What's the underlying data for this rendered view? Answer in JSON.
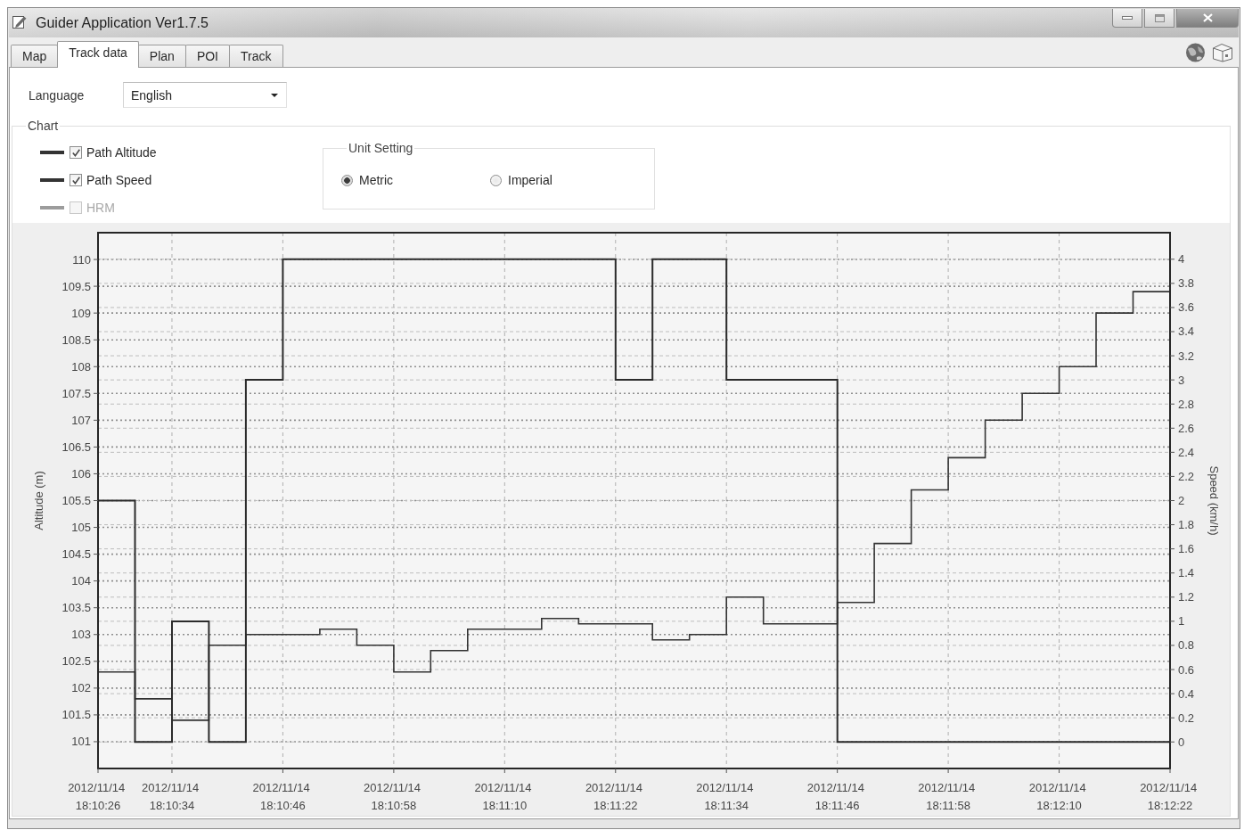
{
  "window": {
    "title": "Guider Application Ver1.7.5"
  },
  "tabs": [
    {
      "label": "Map",
      "selected": false
    },
    {
      "label": "Track data",
      "selected": true
    },
    {
      "label": "Plan",
      "selected": false
    },
    {
      "label": "POI",
      "selected": false
    },
    {
      "label": "Track",
      "selected": false
    }
  ],
  "language": {
    "label": "Language",
    "value": "English"
  },
  "chart_group": {
    "title": "Chart",
    "series_toggles": [
      {
        "label": "Path Altitude",
        "checked": true,
        "disabled": false
      },
      {
        "label": "Path Speed",
        "checked": true,
        "disabled": false
      },
      {
        "label": "HRM",
        "checked": false,
        "disabled": true
      }
    ],
    "unit_setting": {
      "title": "Unit Setting",
      "options": [
        {
          "label": "Metric",
          "selected": true
        },
        {
          "label": "Imperial",
          "selected": false
        }
      ]
    },
    "chart_data": [
      {
        "type": "step",
        "ylabel": "Altitude (m)",
        "y2label": "Speed (km/h)",
        "grid": true,
        "x": [
          "2012-11-14T18:10:26",
          "2012-11-14T18:10:30",
          "2012-11-14T18:10:34",
          "2012-11-14T18:10:38",
          "2012-11-14T18:10:42",
          "2012-11-14T18:10:46",
          "2012-11-14T18:10:50",
          "2012-11-14T18:10:54",
          "2012-11-14T18:10:58",
          "2012-11-14T18:11:02",
          "2012-11-14T18:11:06",
          "2012-11-14T18:11:10",
          "2012-11-14T18:11:14",
          "2012-11-14T18:11:18",
          "2012-11-14T18:11:22",
          "2012-11-14T18:11:26",
          "2012-11-14T18:11:30",
          "2012-11-14T18:11:34",
          "2012-11-14T18:11:38",
          "2012-11-14T18:11:42",
          "2012-11-14T18:11:46",
          "2012-11-14T18:11:50",
          "2012-11-14T18:11:54",
          "2012-11-14T18:11:58",
          "2012-11-14T18:12:02",
          "2012-11-14T18:12:06",
          "2012-11-14T18:12:10",
          "2012-11-14T18:12:14",
          "2012-11-14T18:12:18",
          "2012-11-14T18:12:22"
        ],
        "series": [
          {
            "color": "#333333",
            "values": [
              102.3,
              101.8,
              101.4,
              102.8,
              103.0,
              103.0,
              103.1,
              102.8,
              102.3,
              102.7,
              103.1,
              103.1,
              103.3,
              103.2,
              103.2,
              102.9,
              103.0,
              103.7,
              103.2,
              103.2,
              103.6,
              104.7,
              105.7,
              106.3,
              107.0,
              107.5,
              108.0,
              109.0,
              109.4,
              109.4
            ]
          },
          {
            "color": "#2b2b2b",
            "axis": "y2",
            "values": [
              2,
              0,
              1,
              0,
              3,
              4,
              4,
              4,
              4,
              4,
              4,
              4,
              4,
              4,
              3,
              4,
              4,
              3,
              3,
              3,
              0,
              0,
              0,
              0,
              0,
              0,
              0,
              0,
              0,
              0
            ]
          }
        ],
        "xlim": [
          "2012-11-14T18:10:26",
          "2012-11-14T18:12:22"
        ],
        "ylim": [
          100.5,
          110.5
        ],
        "y2lim": [
          -0.22,
          4.22
        ],
        "xticks": [
          {
            "value": "2012-11-14T18:10:26",
            "label": "2012/11/14 18:10:26"
          },
          {
            "value": "2012-11-14T18:10:34",
            "label": "2012/11/14 18:10:34"
          },
          {
            "value": "2012-11-14T18:10:46",
            "label": "2012/11/14 18:10:46"
          },
          {
            "value": "2012-11-14T18:10:58",
            "label": "2012/11/14 18:10:58"
          },
          {
            "value": "2012-11-14T18:11:10",
            "label": "2012/11/14 18:11:10"
          },
          {
            "value": "2012-11-14T18:11:22",
            "label": "2012/11/14 18:11:22"
          },
          {
            "value": "2012-11-14T18:11:34",
            "label": "2012/11/14 18:11:34"
          },
          {
            "value": "2012-11-14T18:11:46",
            "label": "2012/11/14 18:11:46"
          },
          {
            "value": "2012-11-14T18:11:58",
            "label": "2012/11/14 18:11:58"
          },
          {
            "value": "2012-11-14T18:12:10",
            "label": "2012/11/14 18:12:10"
          },
          {
            "value": "2012-11-14T18:12:22",
            "label": "2012/11/14 18:12:22"
          }
        ],
        "yticks": [
          101,
          101.5,
          102,
          102.5,
          103,
          103.5,
          104,
          104.5,
          105,
          105.5,
          106,
          106.5,
          107,
          107.5,
          108,
          108.5,
          109,
          109.5,
          110
        ],
        "y2ticks": [
          0,
          0.2,
          0.4,
          0.6,
          0.8,
          1,
          1.2,
          1.4,
          1.6,
          1.8,
          2,
          2.2,
          2.4,
          2.6,
          2.8,
          3,
          3.2,
          3.4,
          3.6,
          3.8,
          4
        ]
      }
    ]
  }
}
